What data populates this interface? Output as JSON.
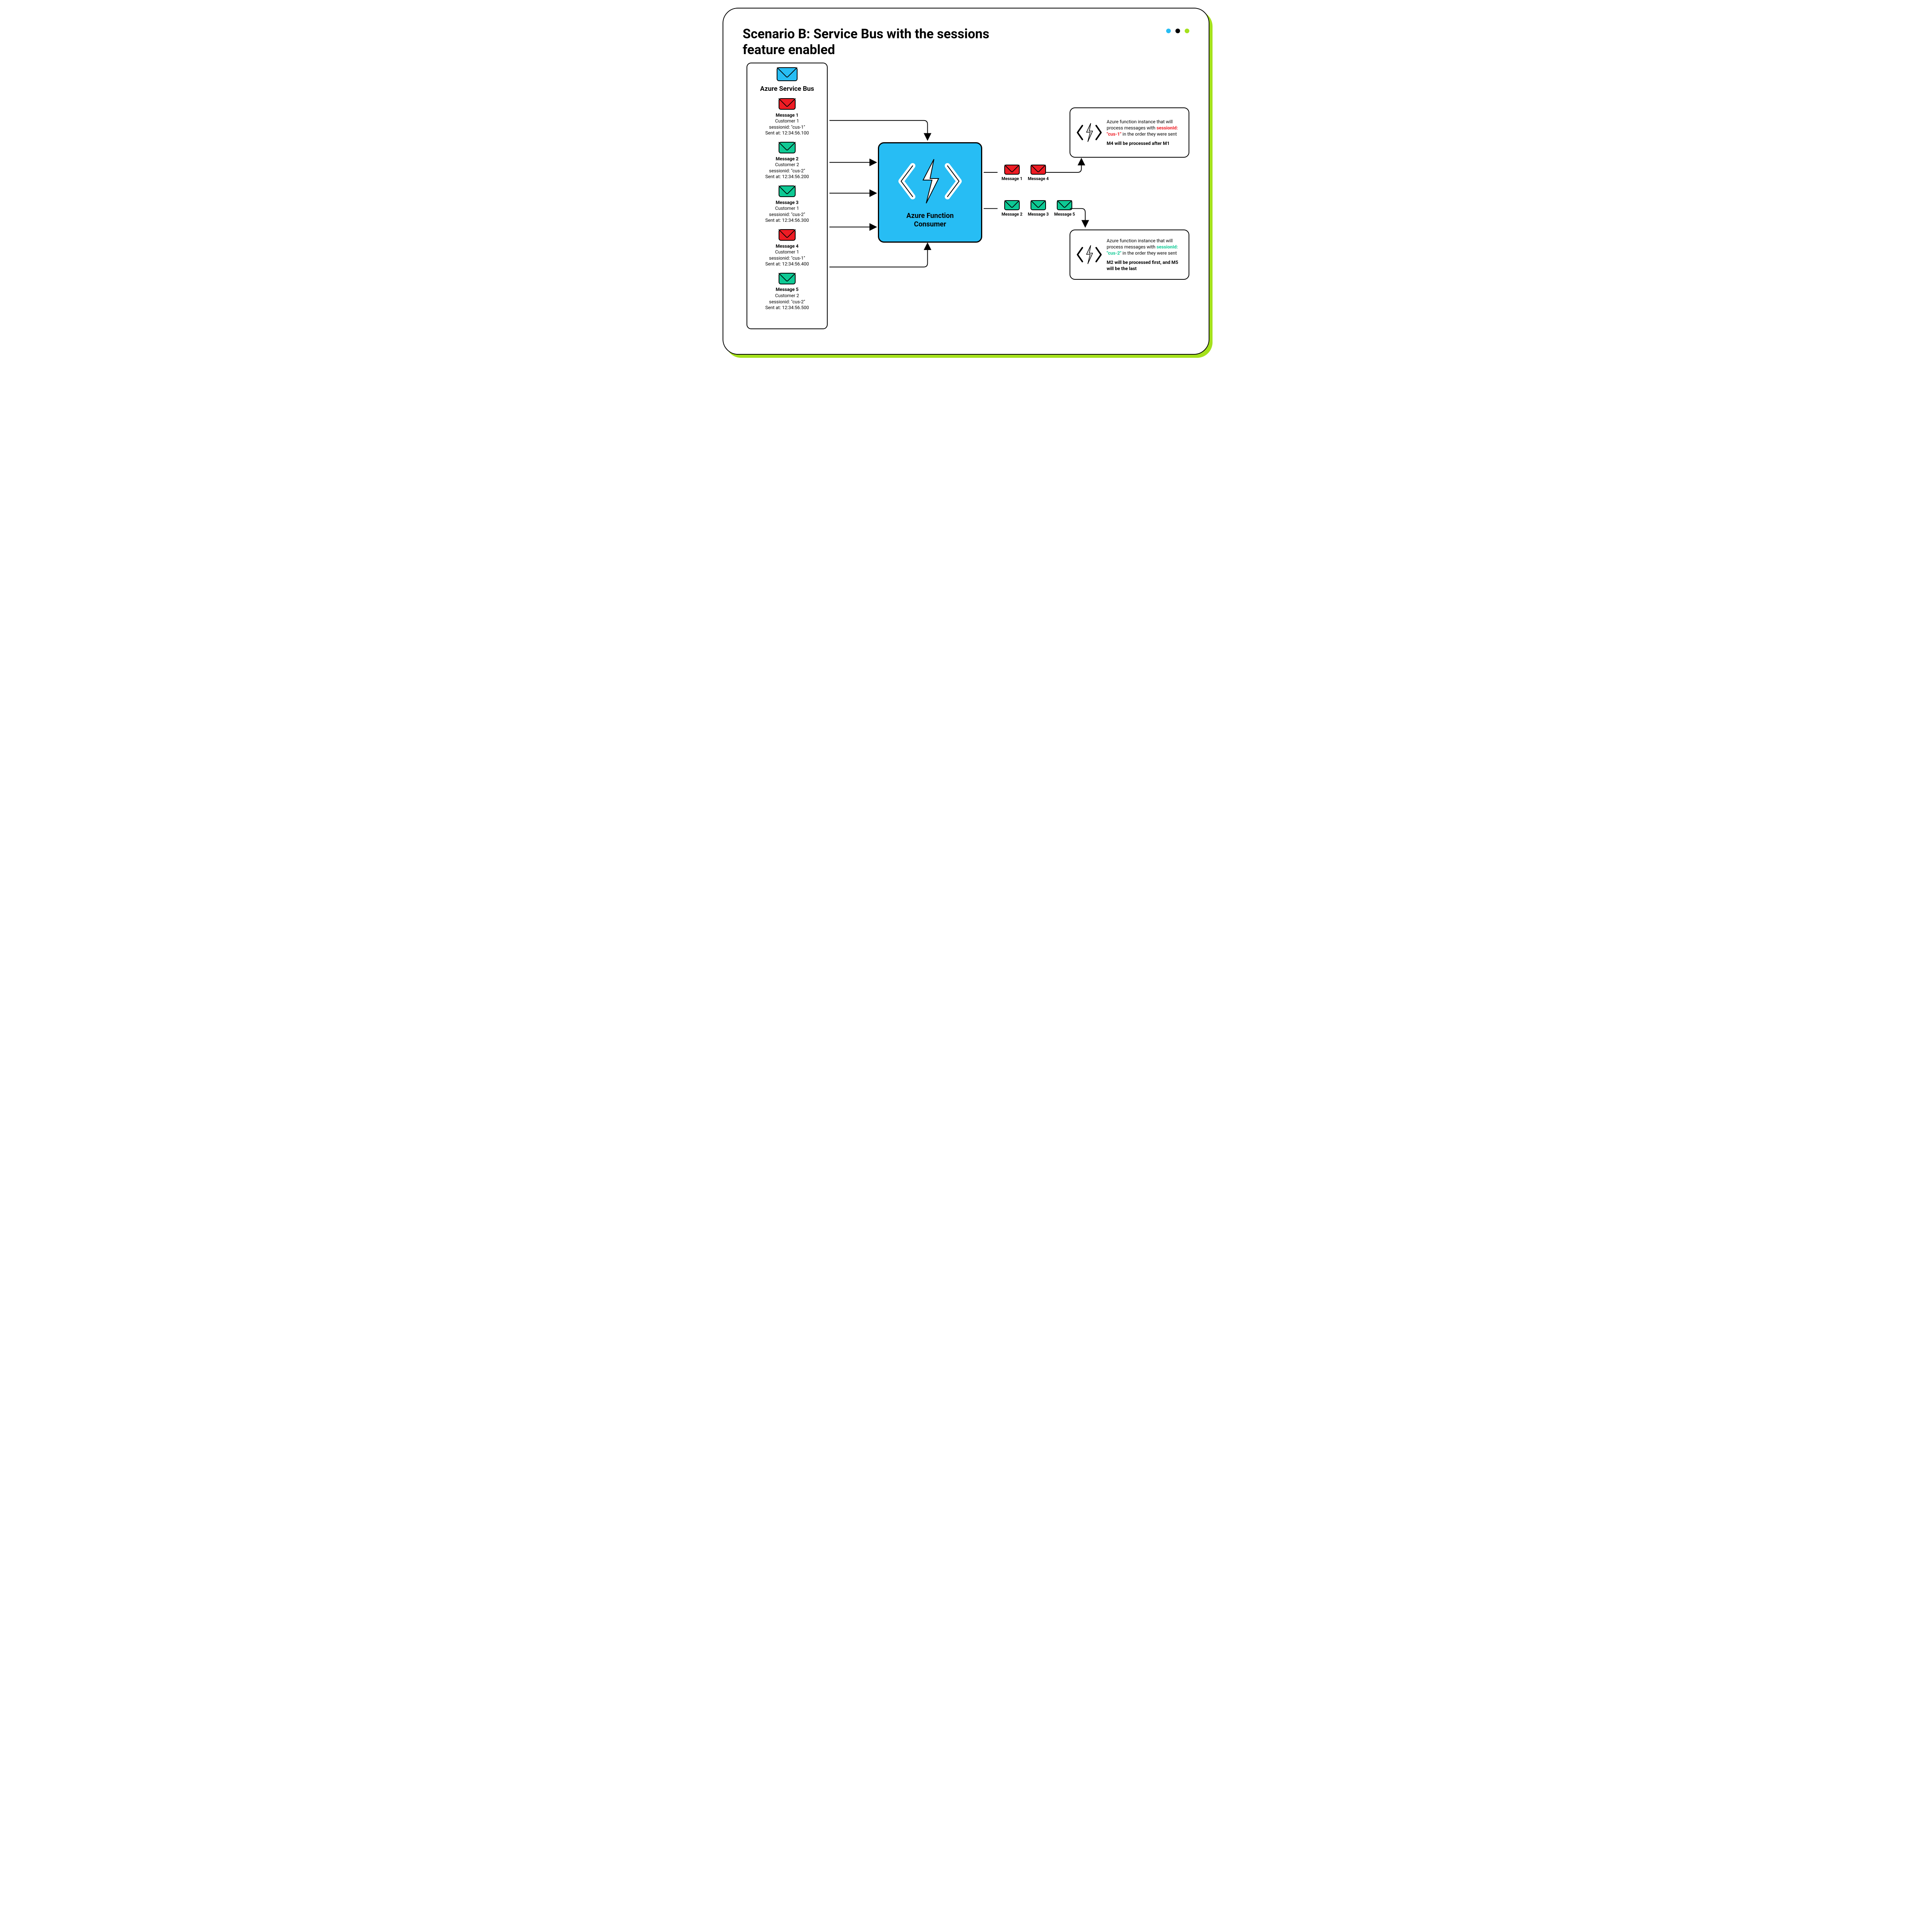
{
  "title": "Scenario B: Service Bus with the sessions feature enabled",
  "bus": {
    "label": "Azure Service Bus",
    "messages": [
      {
        "name": "Message 1",
        "customer": "Customer 1",
        "session": "sessionid: \"cus-1\"",
        "sent": "Sent at: 12:34:56.100",
        "color": "red"
      },
      {
        "name": "Message 2",
        "customer": "Customer 2",
        "session": "sessionid: \"cus-2\"",
        "sent": "Sent at: 12:34:56.200",
        "color": "greenc"
      },
      {
        "name": "Message 3",
        "customer": "Customer 1",
        "session": "sessionid: \"cus-2\"",
        "sent": "Sent at: 12:34:56.300",
        "color": "greenc"
      },
      {
        "name": "Message 4",
        "customer": "Customer 1",
        "session": "sessionid: \"cus-1\"",
        "sent": "Sent at: 12:34:56.400",
        "color": "red"
      },
      {
        "name": "Message 5",
        "customer": "Customer 2",
        "session": "sessionid: \"cus-2\"",
        "sent": "Sent at: 12:34:56.500",
        "color": "greenc"
      }
    ]
  },
  "consumer": {
    "line1": "Azure Function",
    "line2": "Consumer"
  },
  "group1": [
    {
      "label": "Message 1",
      "color": "red"
    },
    {
      "label": "Message 4",
      "color": "red"
    }
  ],
  "group2": [
    {
      "label": "Message 2",
      "color": "greenc"
    },
    {
      "label": "Message 3",
      "color": "greenc"
    },
    {
      "label": "Message 5",
      "color": "greenc"
    }
  ],
  "instance1": {
    "pre": "Azure function instance that will process messages with ",
    "hl": "sessionId: \"cus-1\"",
    "post": " in the order they were sent",
    "note": "M4 will be processed after M1"
  },
  "instance2": {
    "pre": "Azure function instance that will process messages with ",
    "hl": "sessionId: \"cus-2\"",
    "post": " in the order they were sent",
    "note": "M2 will be processed first, and M5 will be the last"
  }
}
